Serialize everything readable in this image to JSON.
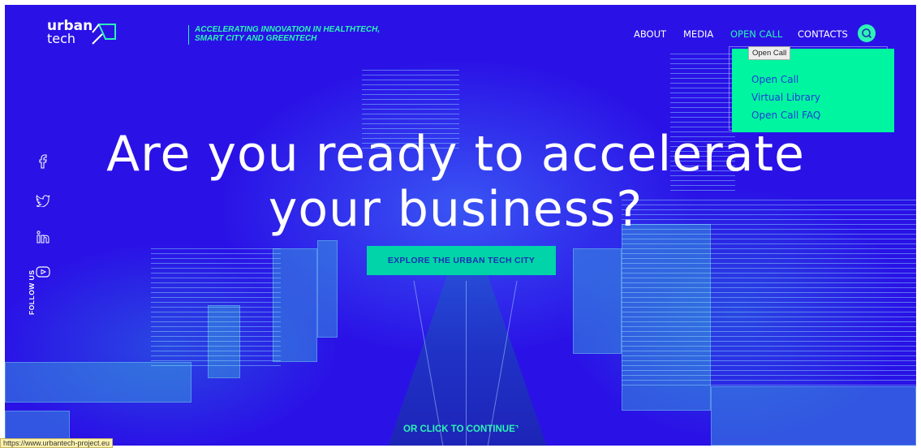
{
  "brand": {
    "logo_line1": "urban",
    "logo_line2": "tech",
    "tagline_line1": "ACCELERATING INNOVATION IN HEALTHTECH,",
    "tagline_line2": "SMART CITY AND GREENTECH"
  },
  "nav": {
    "about": "ABOUT",
    "media": "MEDIA",
    "open_call": "OPEN CALL",
    "contacts": "CONTACTS"
  },
  "dropdown": {
    "tooltip": "Open Call",
    "items": [
      "Open Call",
      "Virtual Library",
      "Open Call FAQ"
    ]
  },
  "hero": {
    "line1": "Are you ready to accelerate",
    "line2": "your business?",
    "cta_label": "EXPLORE THE URBAN TECH CITY",
    "continue_label": "OR CLICK TO CONTINUE"
  },
  "social": {
    "follow_label": "FOLLOW US",
    "icons": [
      "facebook-icon",
      "twitter-icon",
      "linkedin-icon",
      "youtube-icon"
    ]
  },
  "status_url": "https://www.urbantech-project.eu",
  "colors": {
    "background": "#2a12e6",
    "accent": "#2df3b6",
    "dropdown_bg": "#00f5a0",
    "cta_bg": "#00d4a8",
    "link": "#1d3bd9"
  }
}
